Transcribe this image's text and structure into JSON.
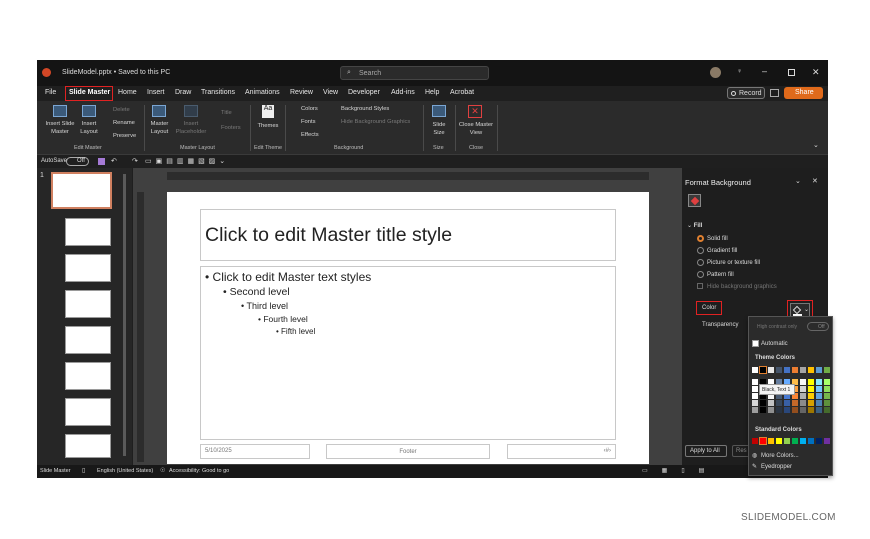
{
  "app": {
    "file_title": "SlideModel.pptx • Saved to this PC",
    "search_placeholder": "Search",
    "record": "Record",
    "share": "Share"
  },
  "tabs": [
    "File",
    "Slide Master",
    "Home",
    "Insert",
    "Draw",
    "Transitions",
    "Animations",
    "Review",
    "View",
    "Developer",
    "Add-ins",
    "Help",
    "Acrobat"
  ],
  "ribbon": {
    "insert_slide_master": "Insert Slide Master",
    "insert_layout": "Insert Layout",
    "delete": "Delete",
    "rename": "Rename",
    "preserve": "Preserve",
    "master_layout": "Master Layout",
    "insert_placeholder": "Insert Placeholder",
    "title": "Title",
    "footers": "Footers",
    "themes": "Themes",
    "colors": "Colors",
    "fonts": "Fonts",
    "effects": "Effects",
    "background_styles": "Background Styles",
    "hide_bg_graphics": "Hide Background Graphics",
    "slide_size": "Slide Size",
    "close_master_view": "Close Master View",
    "groups": {
      "edit_master": "Edit Master",
      "master_layout": "Master Layout",
      "edit_theme": "Edit Theme",
      "background": "Background",
      "size": "Size",
      "close": "Close"
    }
  },
  "qat": {
    "autosave": "AutoSave",
    "toggle": "Off"
  },
  "thumbs": {
    "first_number": "1"
  },
  "slide": {
    "title": "Click to edit Master title style",
    "levels": [
      "Click to edit Master text styles",
      "Second level",
      "Third level",
      "Fourth level",
      "Fifth level"
    ],
    "date": "5/10/2025",
    "footer": "Footer",
    "page_num": "‹#›"
  },
  "format_pane": {
    "title": "Format Background",
    "fill": "Fill",
    "options": [
      "Solid fill",
      "Gradient fill",
      "Picture or texture fill",
      "Pattern fill"
    ],
    "hide_bg": "Hide background graphics",
    "color": "Color",
    "transparency": "Transparency",
    "apply_all": "Apply to All",
    "reset": "Res"
  },
  "color_dropdown": {
    "high_contrast": "High contrast only",
    "off": "Off",
    "automatic": "Automatic",
    "theme_colors": "Theme Colors",
    "tooltip": "Black, Text 1",
    "standard_colors": "Standard Colors",
    "more_colors": "More Colors...",
    "eyedropper": "Eyedropper",
    "theme_row": [
      "#ffffff",
      "#000000",
      "#e8e8e8",
      "#44546a",
      "#4472c4",
      "#ed7d31",
      "#a5a5a5",
      "#ffc000",
      "#5b9bd5",
      "#70ad47"
    ],
    "standard_row": [
      "#c00000",
      "#ff0000",
      "#ffc000",
      "#ffff00",
      "#92d050",
      "#00b050",
      "#00b0f0",
      "#0070c0",
      "#002060",
      "#7030a0"
    ]
  },
  "status": {
    "mode": "Slide Master",
    "language": "English (United States)",
    "accessibility": "Accessibility: Good to go"
  },
  "watermark": "SLIDEMODEL.COM"
}
